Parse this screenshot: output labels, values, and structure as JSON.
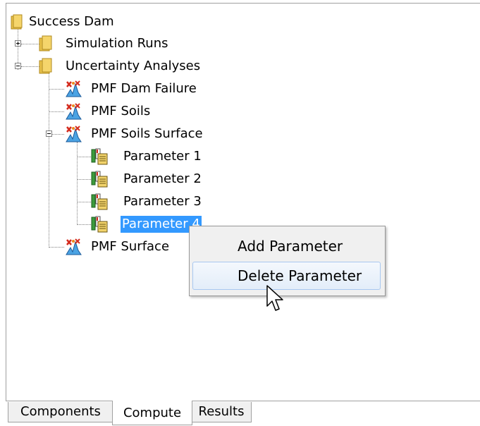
{
  "tree": {
    "root": "Success Dam",
    "simulation_runs": "Simulation Runs",
    "uncertainty_analyses": "Uncertainty Analyses",
    "pmf_dam_failure": "PMF Dam Failure",
    "pmf_soils": "PMF Soils",
    "pmf_soils_surface": "PMF Soils Surface",
    "parameter_1": "Parameter 1",
    "parameter_2": "Parameter 2",
    "parameter_3": "Parameter 3",
    "parameter_4": "Parameter 4",
    "pmf_surface": "PMF Surface"
  },
  "context_menu": {
    "add_parameter": "Add Parameter",
    "delete_parameter": "Delete Parameter"
  },
  "tabs": [
    "Components",
    "Compute",
    "Results"
  ],
  "colors": {
    "selection": "#3399ff",
    "menu_hover_border": "#a8c8f0",
    "folder": "#e8c14a"
  }
}
